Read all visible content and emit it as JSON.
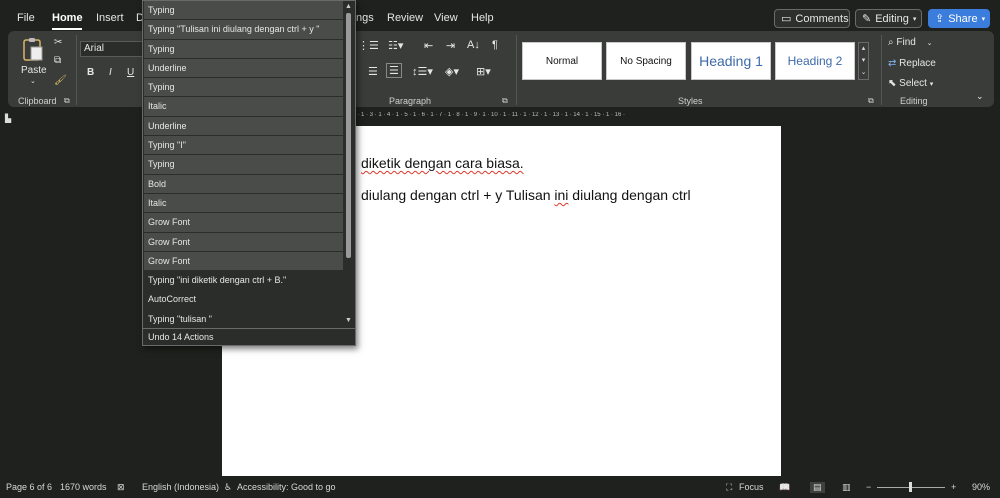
{
  "menu": {
    "file": "File",
    "home": "Home",
    "insert": "Insert",
    "draw_partial": "D",
    "mailings_partial": "ngs",
    "review": "Review",
    "view": "View",
    "help": "Help"
  },
  "top_buttons": {
    "comments": "Comments",
    "editing": "Editing",
    "share": "Share"
  },
  "ribbon": {
    "paste": "Paste",
    "clipboard": "Clipboard",
    "font_name": "Arial",
    "bold": "B",
    "italic": "I",
    "underline": "U",
    "paragraph": "Paragraph",
    "styles": "Styles",
    "editing": "Editing",
    "find": "Find",
    "replace": "Replace",
    "select": "Select",
    "style_cards": [
      "Normal",
      "No Spacing",
      "Heading 1",
      "Heading 2"
    ]
  },
  "ruler_text": "· 1 · 2 · 1 · 3 · 1 · 4 · 1 · 5 · 1 · 6 · 1 · 7 · 1 · 8 · 1 · 9 · 1 · 10 · 1 · 11 · 1 · 12 · 1 · 13 · 1 · 14 · 1 · 15 · 1 · 16 ·",
  "document": {
    "line1_plain": "diketik dengan cara biasa.",
    "line2_a": "diulang dengan ctrl + y Tulisan ",
    "line2_ini": "ini",
    "line2_b": " diulang dengan ctrl"
  },
  "undo_dropdown": {
    "items": [
      "Typing",
      "Typing \"Tulisan ini diulang dengan ctrl + y \"",
      "Typing",
      "Underline",
      "Typing",
      "Italic",
      "Underline",
      "Typing \"I\"",
      "Typing",
      "Bold",
      "Italic",
      "Grow Font",
      "Grow Font",
      "Grow Font",
      "Typing \"ini diketik dengan ctrl + B.\"",
      "AutoCorrect",
      "Typing \"tulisan \""
    ],
    "selected_count": 14,
    "footer": "Undo 14 Actions"
  },
  "status": {
    "page": "Page 6 of 6",
    "words": "1670 words",
    "language": "English (Indonesia)",
    "accessibility": "Accessibility: Good to go",
    "focus": "Focus",
    "zoom": "90%"
  }
}
